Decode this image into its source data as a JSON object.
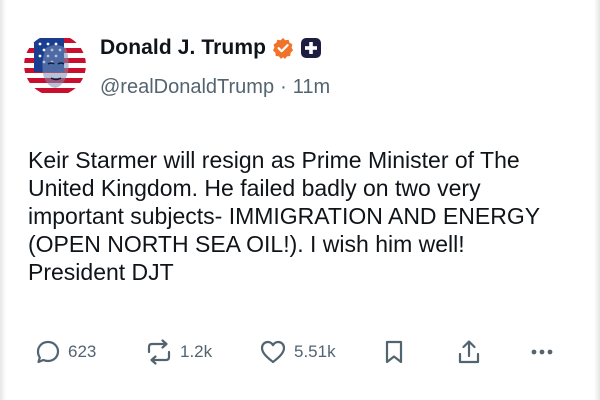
{
  "post": {
    "display_name": "Donald J. Trump",
    "handle": "@realDonaldTrump",
    "separator": "·",
    "time_ago": "11m",
    "verified_icon": "verified-badge-icon",
    "badge_icon": "truth-social-plus-icon",
    "avatar": "profile-avatar",
    "text": "Keir Starmer will resign as Prime Minister of The United Kingdom. He failed badly on two very important subjects- IMMIGRATION AND ENERGY (OPEN NORTH SEA OIL!). I wish him well! President DJT"
  },
  "actions": {
    "replies": {
      "icon": "reply-bubble-icon",
      "count": "623"
    },
    "retruths": {
      "icon": "repost-icon",
      "count": "1.2k"
    },
    "likes": {
      "icon": "heart-icon",
      "count": "5.51k"
    },
    "bookmark": {
      "icon": "bookmark-icon"
    },
    "share": {
      "icon": "share-icon"
    },
    "more": {
      "icon": "more-options-icon"
    }
  },
  "colors": {
    "text": "#0f1419",
    "muted": "#536471",
    "verified": "#f1732a",
    "badge": "#1d1d3f"
  }
}
